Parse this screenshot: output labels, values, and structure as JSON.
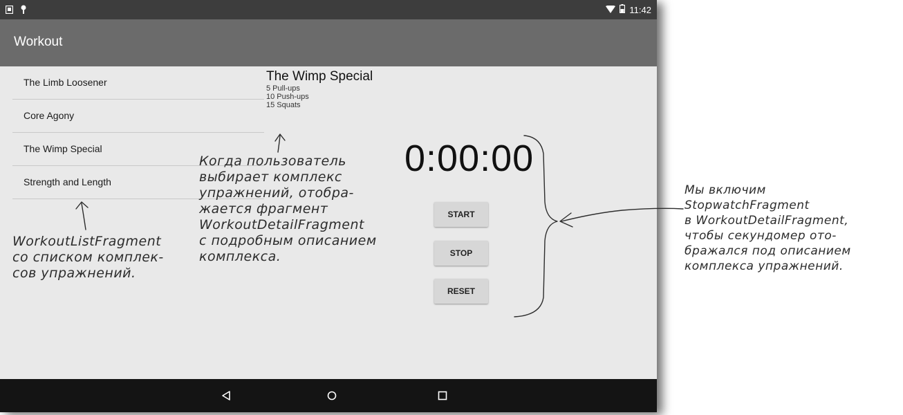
{
  "status_bar": {
    "time": "11:42",
    "left_icons": [
      "screen-icon",
      "android-icon"
    ],
    "right_icons": [
      "wifi-icon",
      "battery-icon"
    ]
  },
  "app_bar": {
    "title": "Workout"
  },
  "workout_list": {
    "items": [
      "The Limb Loosener",
      "Core Agony",
      "The Wimp Special",
      "Strength and Length"
    ]
  },
  "detail": {
    "title": "The Wimp Special",
    "exercises": [
      "5 Pull-ups",
      "10 Push-ups",
      "15 Squats"
    ]
  },
  "stopwatch": {
    "time": "0:00:00",
    "start_label": "START",
    "stop_label": "STOP",
    "reset_label": "RESET"
  },
  "nav_bar": {
    "icons": [
      "back-icon",
      "home-icon",
      "recents-icon"
    ]
  },
  "annotations": {
    "list": [
      "WorkoutListFragment",
      "со списком комплек-",
      "сов упражнений."
    ],
    "detail": [
      "Когда пользователь",
      "выбирает комплекс",
      "упражнений, отобра-",
      "жается фрагмент",
      "WorkoutDetailFragment",
      "с подробным описанием",
      "комплекса."
    ],
    "stopwatch": [
      "Мы включим",
      "StopwatchFragment",
      "в WorkoutDetailFragment,",
      "чтобы секундомер ото-",
      "бражался под описанием",
      "комплекса упражнений."
    ]
  }
}
